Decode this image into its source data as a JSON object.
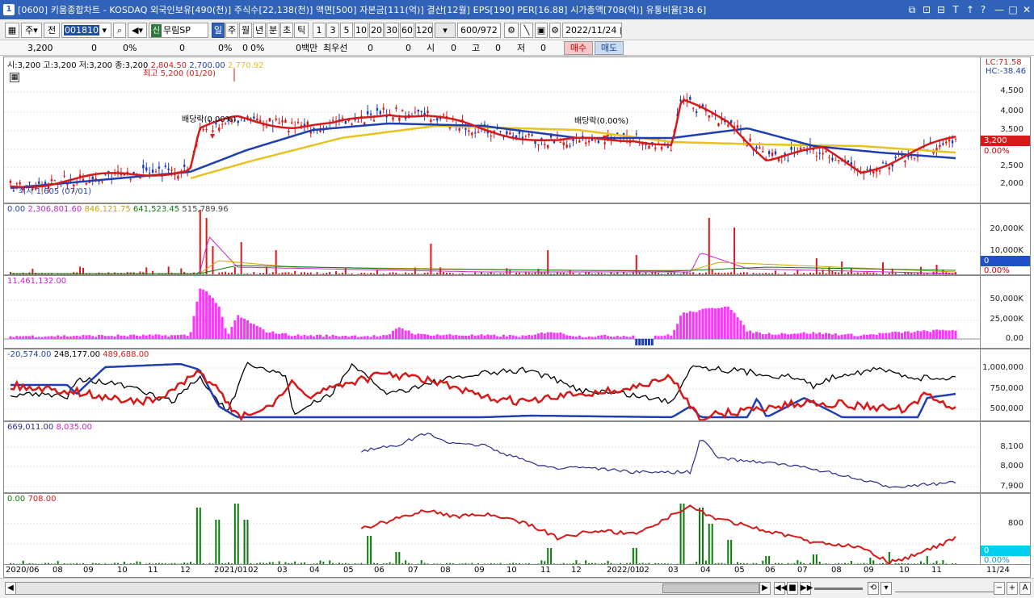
{
  "window": {
    "icon": "1",
    "title": "[0600] 키움종합차트 - KOSDAQ 외국인보유[490(천)] 주식수[22,138(천)] 액면[500] 자본금[111(억)] 결산[12월] EPS[190] PER[16.88] 시가총액[708(억)] 유통비율[38.6]",
    "controls": [
      "⧉",
      "⊡",
      "⊟",
      "T",
      "↑",
      "?",
      "—",
      "□",
      "✕"
    ]
  },
  "toolbar": {
    "period_selected": "주",
    "prev_label": "전",
    "stock_code": "001810",
    "stock_badge": "신",
    "stock_name": "무림SP",
    "periods": [
      "일",
      "주",
      "월",
      "년",
      "분",
      "초",
      "틱"
    ],
    "intervals": [
      "1",
      "3",
      "5",
      "10",
      "20",
      "30",
      "60",
      "120"
    ],
    "count": "600/972",
    "date": "2022/11/24"
  },
  "pricebar": {
    "price": "3,200",
    "change": "0",
    "change_pct": "0%",
    "v1": "0",
    "v1_pct": "0%",
    "v2": "0",
    "v2_pct": "0%",
    "amount": "0백만",
    "best_label": "최우선",
    "best_v1": "0",
    "best_v2": "0",
    "si_label": "시",
    "si_val": "0",
    "go_label": "고",
    "go_val": "0",
    "jeo_label": "저",
    "jeo_val": "0",
    "buy": "매수",
    "sell": "매도"
  },
  "panels": {
    "price": {
      "legend": {
        "ohlc": "시:3,200 고:3,200 저:3,200 종:3,200",
        "ma1": "2,804.50",
        "ma2": "2,700.00",
        "ma3": "2,770.92"
      },
      "ticks": [
        "4,500",
        "4,000",
        "3,500",
        "3,000",
        "2,500",
        "2,000"
      ],
      "lc": "LC:71.58",
      "hc": "HC:-38.46",
      "current": "3,200",
      "current_pct": "0.00%",
      "annotations": {
        "high": "최고 5,200 (01/20)",
        "low": "최저 1,605 (07/01)",
        "div1": "배당락(0.00%)",
        "div2": "배당락(0.00%)"
      }
    },
    "volume": {
      "legend": {
        "v0": "0.00",
        "v1": "2,306,801.60",
        "v2": "846,121.75",
        "v3": "641,523.45",
        "v4": "515,789.96"
      },
      "ticks": [
        "20,000K",
        "10,000K",
        "0.00%"
      ],
      "current": "0"
    },
    "amount": {
      "legend": "11,461,132.00",
      "ticks": [
        "50,000K",
        "25,000K",
        "0.00"
      ]
    },
    "investor": {
      "legend": {
        "v1": "-20,574.00",
        "v2": "248,177.00",
        "v3": "489,688.00"
      },
      "ticks": [
        "1,000,000",
        "750,000",
        "500,000"
      ]
    },
    "indicator": {
      "legend": {
        "v1": "669,011.00",
        "v2": "8,035.00"
      },
      "ticks": [
        "8,100",
        "8,000",
        "7,900"
      ]
    },
    "ratio": {
      "legend": {
        "v1": "0.00",
        "v2": "708.00"
      },
      "ticks": [
        "800"
      ],
      "current": "0",
      "current_pct": "0.00%"
    }
  },
  "dates": [
    "2020/06",
    "08",
    "09",
    "10",
    "11",
    "12",
    "2021/01",
    "02",
    "03",
    "04",
    "05",
    "06",
    "07",
    "08",
    "09",
    "10",
    "11",
    "12",
    "2022/01",
    "02",
    "03",
    "04",
    "05",
    "06",
    "07",
    "08",
    "09",
    "10",
    "11",
    "11/24"
  ],
  "colors": {
    "titlebar": "#2f62b8",
    "up": "#d61a1a",
    "down": "#1f3fb0",
    "ma_yellow": "#e8c21e",
    "magenta": "#ff33ff",
    "green": "#0a7a0a",
    "navy": "#2b2a8a",
    "cyan_badge": "#00d0f0"
  }
}
